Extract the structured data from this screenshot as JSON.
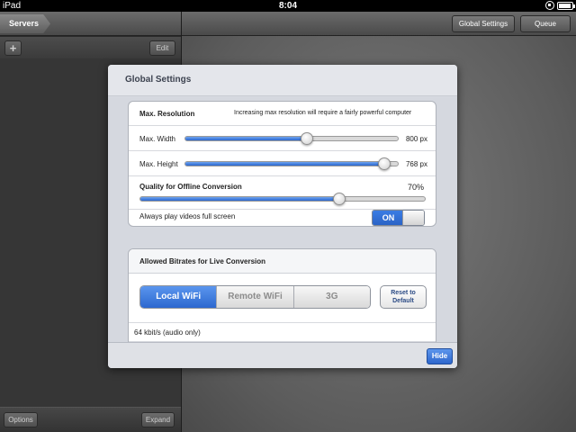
{
  "status_bar": {
    "carrier": "iPad",
    "time": "8:04"
  },
  "left_pane": {
    "back_button": "Servers",
    "toolbar": {
      "add_label": "+",
      "edit_label": "Edit"
    },
    "bottom": {
      "options_label": "Options",
      "expand_label": "Expand"
    }
  },
  "right_nav": {
    "global_settings_label": "Global Settings",
    "queue_label": "Queue"
  },
  "modal": {
    "title": "Global Settings",
    "resolution": {
      "header": "Max. Resolution",
      "note": "Increasing max resolution will require a fairly powerful computer",
      "width_label": "Max. Width",
      "width_value": "800 px",
      "width_fraction": 0.57,
      "height_label": "Max. Height",
      "height_value": "768 px",
      "height_fraction": 0.935
    },
    "quality": {
      "label": "Quality for Offline Conversion",
      "value": "70%",
      "fraction": 0.7
    },
    "fullscreen": {
      "label": "Always play videos full screen",
      "toggle_label": "ON",
      "is_on": true
    },
    "bitrates": {
      "header": "Allowed Bitrates for Live Conversion",
      "segments": [
        "Local WiFi",
        "Remote WiFi",
        "3G"
      ],
      "selected_segment": "Local WiFi",
      "reset_line1": "Reset to",
      "reset_line2": "Default",
      "first_row": "64 kbit/s (audio only)"
    },
    "hide_label": "Hide"
  },
  "colors": {
    "accent_blue": "#2c67cf",
    "slider_blue": "#4a86e6"
  }
}
